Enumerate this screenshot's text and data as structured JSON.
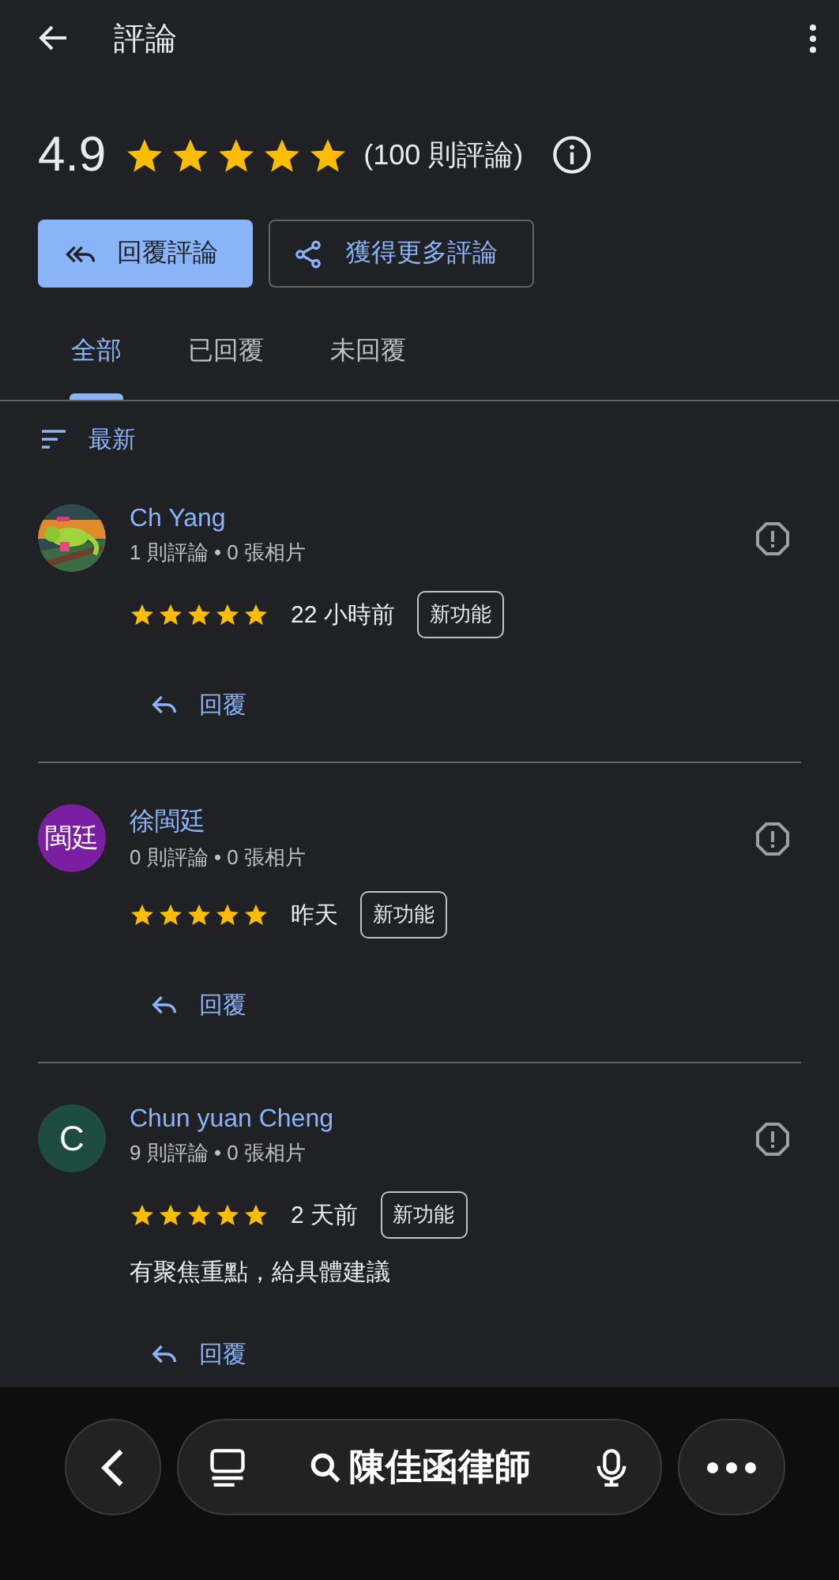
{
  "header": {
    "title": "評論"
  },
  "summary": {
    "rating": "4.9",
    "stars": 5,
    "count": "(100 則評論)"
  },
  "actions": [
    {
      "kind": "primary",
      "label": "回覆評論"
    },
    {
      "kind": "outline",
      "label": "獲得更多評論"
    }
  ],
  "tabs": [
    {
      "label": "全部",
      "selected": true
    },
    {
      "label": "已回覆",
      "selected": false
    },
    {
      "label": "未回覆",
      "selected": false
    }
  ],
  "sort": {
    "label": "最新"
  },
  "reviews": [
    {
      "author": "Ch Yang",
      "meta": "1 則評論 • 0 張相片",
      "stars": 5,
      "time": "22 小時前",
      "badge": "新功能",
      "reply": "回覆"
    },
    {
      "author": "徐閩廷",
      "avatar": {
        "kind": "initials",
        "text": "閩廷",
        "color": "#7b1fa2"
      },
      "meta": "0 則評論 • 0 張相片",
      "stars": 5,
      "time": "昨天",
      "badge": "新功能",
      "reply": "回覆"
    },
    {
      "author": "Chun yuan Cheng",
      "avatar": {
        "kind": "initials",
        "text": "C",
        "color": "#1e4d3f"
      },
      "meta": "9 則評論 • 0 張相片",
      "stars": 5,
      "time": "2 天前",
      "badge": "新功能",
      "text": "有聚焦重點，給具體建議",
      "reply": "回覆"
    }
  ],
  "bottom_bar": {
    "search": "陳佳函律師"
  }
}
